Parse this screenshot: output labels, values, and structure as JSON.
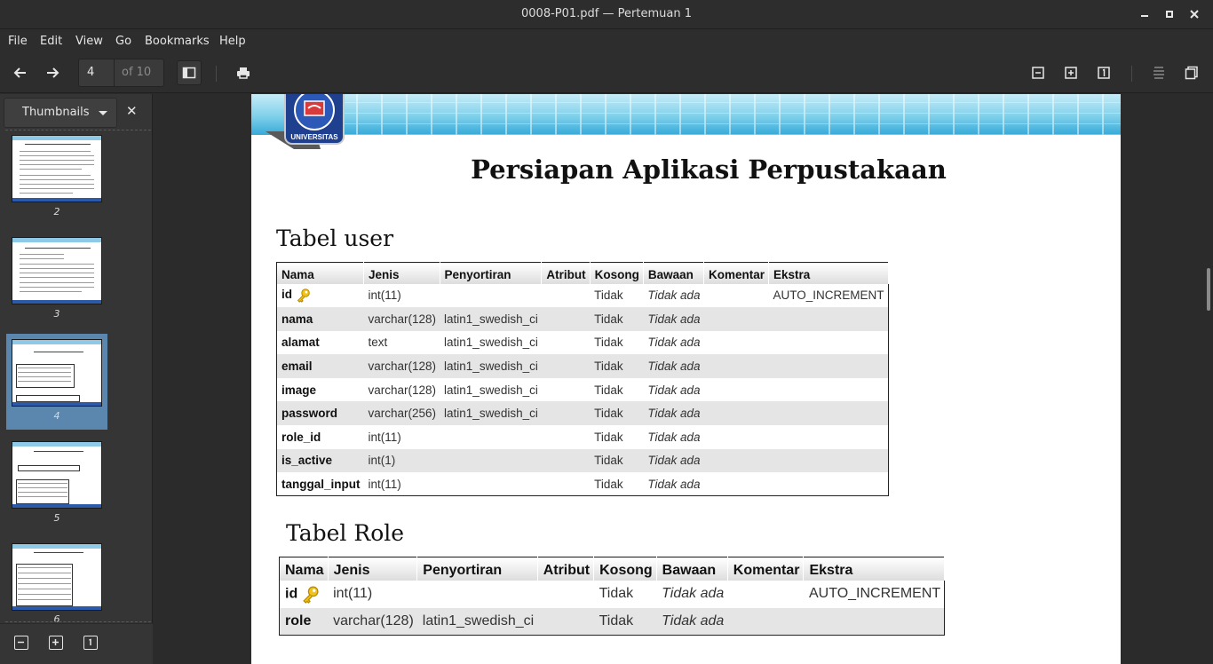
{
  "window": {
    "title": "0008-P01.pdf — Pertemuan 1"
  },
  "menu": [
    "File",
    "Edit",
    "View",
    "Go",
    "Bookmarks",
    "Help"
  ],
  "toolbar": {
    "page_value": "4",
    "page_total": "of 10"
  },
  "sidebar": {
    "mode_label": "Thumbnails",
    "thumbnails": [
      {
        "page": "2"
      },
      {
        "page": "3"
      },
      {
        "page": "4"
      },
      {
        "page": "5"
      },
      {
        "page": "6"
      }
    ],
    "selected_page": "4"
  },
  "document": {
    "logo_text": "UNIVERSITAS",
    "title": "Persiapan Aplikasi Perpustakaan",
    "table_user": {
      "heading": "Tabel user",
      "columns": [
        "Nama",
        "Jenis",
        "Penyortiran",
        "Atribut",
        "Kosong",
        "Bawaan",
        "Komentar",
        "Ekstra"
      ],
      "rows": [
        [
          "id",
          "int(11)",
          "",
          "",
          "Tidak",
          "Tidak ada",
          "",
          "AUTO_INCREMENT"
        ],
        [
          "nama",
          "varchar(128)",
          "latin1_swedish_ci",
          "",
          "Tidak",
          "Tidak ada",
          "",
          ""
        ],
        [
          "alamat",
          "text",
          "latin1_swedish_ci",
          "",
          "Tidak",
          "Tidak ada",
          "",
          ""
        ],
        [
          "email",
          "varchar(128)",
          "latin1_swedish_ci",
          "",
          "Tidak",
          "Tidak ada",
          "",
          ""
        ],
        [
          "image",
          "varchar(128)",
          "latin1_swedish_ci",
          "",
          "Tidak",
          "Tidak ada",
          "",
          ""
        ],
        [
          "password",
          "varchar(256)",
          "latin1_swedish_ci",
          "",
          "Tidak",
          "Tidak ada",
          "",
          ""
        ],
        [
          "role_id",
          "int(11)",
          "",
          "",
          "Tidak",
          "Tidak ada",
          "",
          ""
        ],
        [
          "is_active",
          "int(1)",
          "",
          "",
          "Tidak",
          "Tidak ada",
          "",
          ""
        ],
        [
          "tanggal_input",
          "int(11)",
          "",
          "",
          "Tidak",
          "Tidak ada",
          "",
          ""
        ]
      ]
    },
    "table_role": {
      "heading": "Tabel Role",
      "columns": [
        "Nama",
        "Jenis",
        "Penyortiran",
        "Atribut",
        "Kosong",
        "Bawaan",
        "Komentar",
        "Ekstra"
      ],
      "rows": [
        [
          "id",
          "int(11)",
          "",
          "",
          "Tidak",
          "Tidak ada",
          "",
          "AUTO_INCREMENT"
        ],
        [
          "role",
          "varchar(128)",
          "latin1_swedish_ci",
          "",
          "Tidak",
          "Tidak ada",
          "",
          ""
        ]
      ]
    }
  },
  "colors": {
    "chrome": "#2d2d2d",
    "selection": "#5b86ad",
    "banner": "#36a9d8"
  }
}
